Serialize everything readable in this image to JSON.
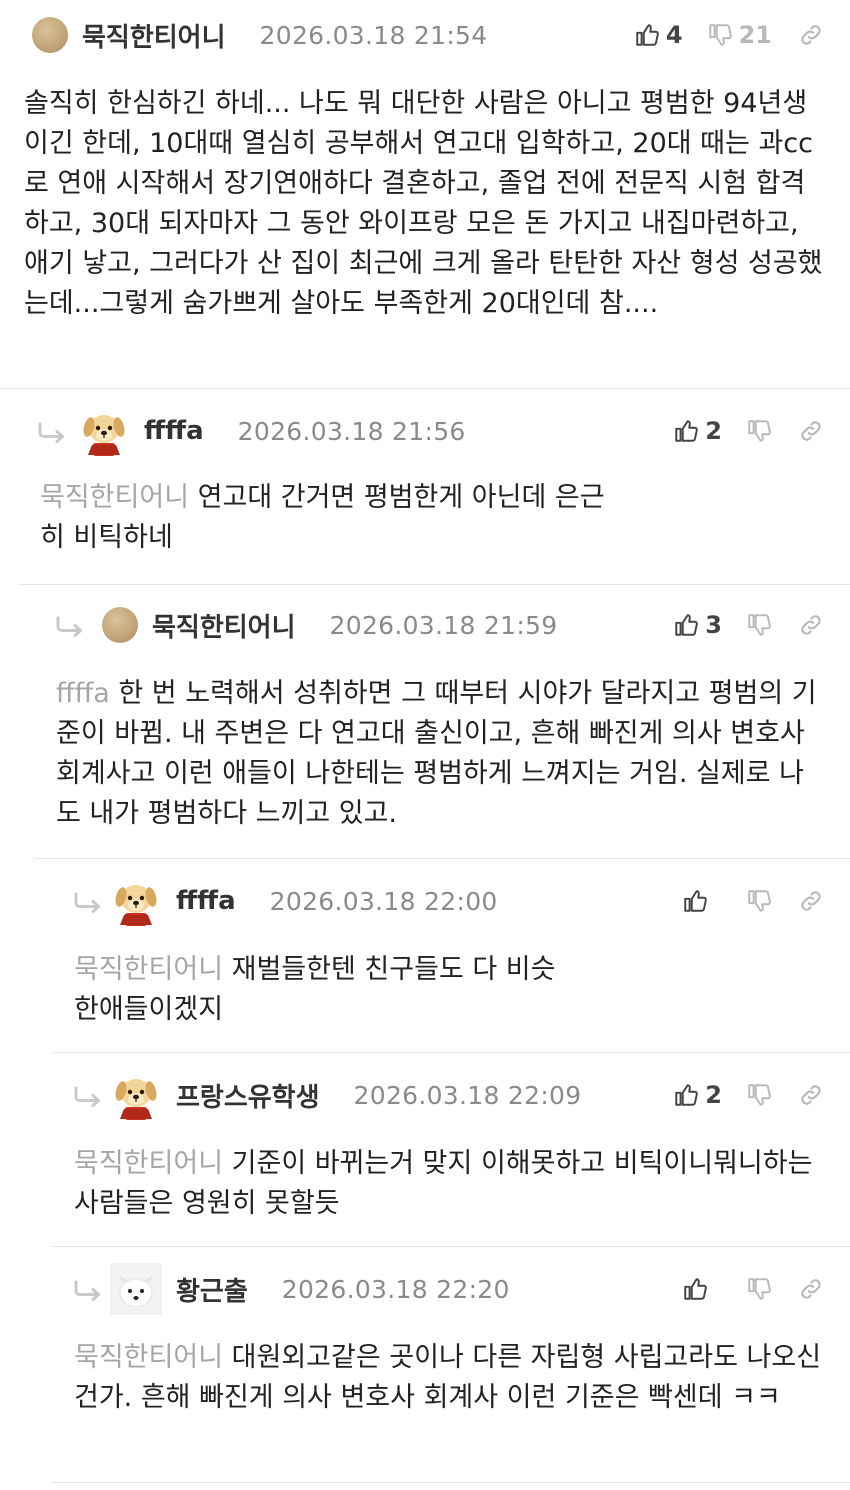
{
  "comments": [
    {
      "nick": "묵직한티어니",
      "date": "2026.03.18 21:54",
      "likes": "4",
      "dislikes": "21",
      "mention": "",
      "text": "솔직히 한심하긴 하네... 나도 뭐 대단한 사람은 아니고 평범한 94년생이긴 한데, 10대때 열심히 공부해서 연고대 입학하고, 20대 때는 과cc로 연애 시작해서 장기연애하다 결혼하고, 졸업 전에 전문직 시험 합격하고, 30대 되자마자 그 동안 와이프랑 모은 돈 가지고 내집마련하고, 애기 낳고, 그러다가 산 집이 최근에 크게 올라 탄탄한 자산 형성 성공했는데...그렇게 숨가쁘게 살아도 부족한게 20대인데 참....",
      "avatar": "ball-icon"
    },
    {
      "nick": "ffffa",
      "date": "2026.03.18 21:56",
      "likes": "2",
      "dislikes": "",
      "mention": "묵직한티어니",
      "text": "연고대 간거면 평범한게 아닌데 은근히 비틱하네",
      "avatar": "puppy-icon"
    },
    {
      "nick": "묵직한티어니",
      "date": "2026.03.18 21:59",
      "likes": "3",
      "dislikes": "",
      "mention": "ffffa",
      "text": "한 번 노력해서 성취하면 그 때부터 시야가 달라지고 평범의 기준이 바뀜. 내 주변은 다 연고대 출신이고, 흔해 빠진게 의사 변호사 회계사고 이런 애들이 나한테는 평범하게 느껴지는 거임. 실제로 나도 내가 평범하다 느끼고 있고.",
      "avatar": "ball-icon"
    },
    {
      "nick": "ffffa",
      "date": "2026.03.18 22:00",
      "likes": "",
      "dislikes": "",
      "mention": "묵직한티어니",
      "text": "재벌들한텐 친구들도 다 비슷한애들이겠지",
      "avatar": "puppy-icon"
    },
    {
      "nick": "프랑스유학생",
      "date": "2026.03.18 22:09",
      "likes": "2",
      "dislikes": "",
      "mention": "묵직한티어니",
      "text": "기준이 바뀌는거 맞지 이해못하고 비틱이니뭐니하는 사람들은 영원히 못할듯",
      "avatar": "puppy-icon"
    },
    {
      "nick": "황근출",
      "date": "2026.03.18 22:20",
      "likes": "",
      "dislikes": "",
      "mention": "묵직한티어니",
      "text": "대원외고같은 곳이나 다른 자립형 사립고라도 나오신 건가. 흔해 빠진게 의사 변호사 회계사 이런 기준은 빡센데 ㅋㅋ",
      "avatar": "dog-icon"
    }
  ],
  "colors": {
    "nick": "#333333",
    "date": "#8a8a8a",
    "mention": "#a6a6a6",
    "icon": "#444444",
    "icon_dim": "#b9b9b9",
    "divider": "#e6e6e6"
  }
}
